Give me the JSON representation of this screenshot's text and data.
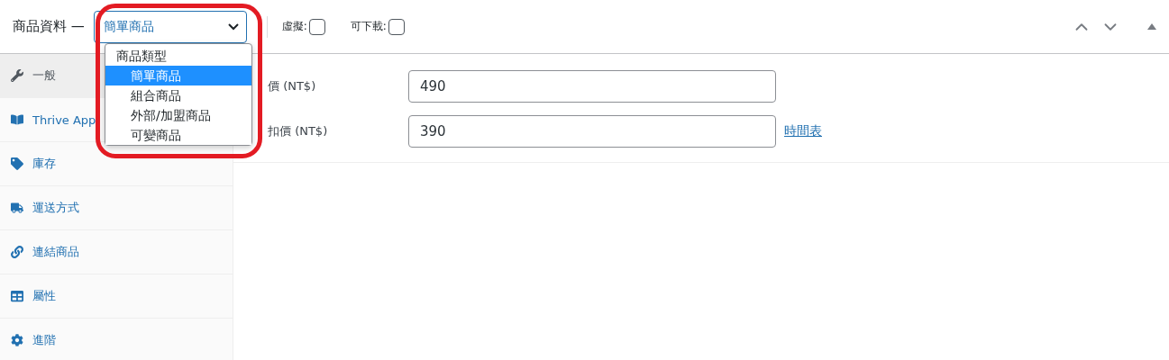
{
  "header": {
    "title": "商品資料 —",
    "product_type": {
      "value": "簡單商品",
      "expanded": true
    },
    "options": [
      {
        "label": "虛擬:",
        "checked": false
      },
      {
        "label": "可下載:",
        "checked": false
      }
    ]
  },
  "dropdown": {
    "group": "商品類型",
    "items": [
      {
        "label": "簡單商品",
        "selected": true
      },
      {
        "label": "組合商品",
        "selected": false
      },
      {
        "label": "外部/加盟商品",
        "selected": false
      },
      {
        "label": "可變商品",
        "selected": false
      }
    ]
  },
  "sidebar": {
    "items": [
      {
        "label": "一般",
        "selected": true
      },
      {
        "label": "Thrive App",
        "selected": false
      },
      {
        "label": "庫存",
        "selected": false
      },
      {
        "label": "運送方式",
        "selected": false
      },
      {
        "label": "連結商品",
        "selected": false
      },
      {
        "label": "屬性",
        "selected": false
      },
      {
        "label": "進階",
        "selected": false
      }
    ]
  },
  "fields": [
    {
      "label": "價 (NT$)",
      "value": "490"
    },
    {
      "label": "扣價 (NT$)",
      "value": "390",
      "link": "時間表"
    }
  ]
}
